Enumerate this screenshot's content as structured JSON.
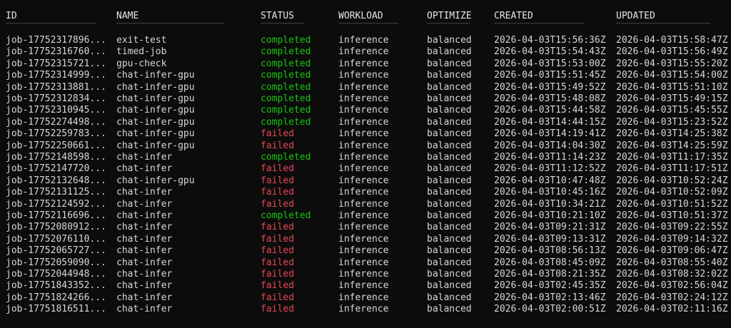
{
  "colors": {
    "background": "#0c0c0c",
    "text": "#d7d7d7",
    "completed": "#16c60c",
    "failed": "#e74856",
    "separator": "#4a4a4a"
  },
  "table": {
    "headers": {
      "id": "ID",
      "name": "NAME",
      "status": "STATUS",
      "workload": "WORKLOAD",
      "optimize": "OPTIMIZE",
      "created": "CREATED",
      "updated": "UPDATED"
    },
    "separators": {
      "id": "─────────────────────",
      "name": "─────────────────────────",
      "status": "──────────",
      "workload": "──────────────",
      "optimize": "──────────",
      "created": "─────────────────────",
      "updated": "──────────────────────"
    },
    "rows": [
      {
        "id": "job-17752317896...",
        "name": "exit-test",
        "status": "completed",
        "workload": "inference",
        "optimize": "balanced",
        "created": "2026-04-03T15:56:36Z",
        "updated": "2026-04-03T15:58:47Z"
      },
      {
        "id": "job-17752316760...",
        "name": "timed-job",
        "status": "completed",
        "workload": "inference",
        "optimize": "balanced",
        "created": "2026-04-03T15:54:43Z",
        "updated": "2026-04-03T15:56:49Z"
      },
      {
        "id": "job-17752315721...",
        "name": "gpu-check",
        "status": "completed",
        "workload": "inference",
        "optimize": "balanced",
        "created": "2026-04-03T15:53:00Z",
        "updated": "2026-04-03T15:55:20Z"
      },
      {
        "id": "job-17752314999...",
        "name": "chat-infer-gpu",
        "status": "completed",
        "workload": "inference",
        "optimize": "balanced",
        "created": "2026-04-03T15:51:45Z",
        "updated": "2026-04-03T15:54:00Z"
      },
      {
        "id": "job-17752313881...",
        "name": "chat-infer-gpu",
        "status": "completed",
        "workload": "inference",
        "optimize": "balanced",
        "created": "2026-04-03T15:49:52Z",
        "updated": "2026-04-03T15:51:10Z"
      },
      {
        "id": "job-17752312834...",
        "name": "chat-infer-gpu",
        "status": "completed",
        "workload": "inference",
        "optimize": "balanced",
        "created": "2026-04-03T15:48:08Z",
        "updated": "2026-04-03T15:49:15Z"
      },
      {
        "id": "job-17752310945...",
        "name": "chat-infer-gpu",
        "status": "completed",
        "workload": "inference",
        "optimize": "balanced",
        "created": "2026-04-03T15:44:58Z",
        "updated": "2026-04-03T15:45:55Z"
      },
      {
        "id": "job-17752274498...",
        "name": "chat-infer-gpu",
        "status": "completed",
        "workload": "inference",
        "optimize": "balanced",
        "created": "2026-04-03T14:44:15Z",
        "updated": "2026-04-03T15:23:52Z"
      },
      {
        "id": "job-17752259783...",
        "name": "chat-infer-gpu",
        "status": "failed",
        "workload": "inference",
        "optimize": "balanced",
        "created": "2026-04-03T14:19:41Z",
        "updated": "2026-04-03T14:25:38Z"
      },
      {
        "id": "job-17752250661...",
        "name": "chat-infer-gpu",
        "status": "failed",
        "workload": "inference",
        "optimize": "balanced",
        "created": "2026-04-03T14:04:30Z",
        "updated": "2026-04-03T14:25:59Z"
      },
      {
        "id": "job-17752148598...",
        "name": "chat-infer",
        "status": "completed",
        "workload": "inference",
        "optimize": "balanced",
        "created": "2026-04-03T11:14:23Z",
        "updated": "2026-04-03T11:17:35Z"
      },
      {
        "id": "job-17752147720...",
        "name": "chat-infer",
        "status": "failed",
        "workload": "inference",
        "optimize": "balanced",
        "created": "2026-04-03T11:12:52Z",
        "updated": "2026-04-03T11:17:51Z"
      },
      {
        "id": "job-17752132648...",
        "name": "chat-infer-gpu",
        "status": "failed",
        "workload": "inference",
        "optimize": "balanced",
        "created": "2026-04-03T10:47:48Z",
        "updated": "2026-04-03T10:52:24Z"
      },
      {
        "id": "job-17752131125...",
        "name": "chat-infer",
        "status": "failed",
        "workload": "inference",
        "optimize": "balanced",
        "created": "2026-04-03T10:45:16Z",
        "updated": "2026-04-03T10:52:09Z"
      },
      {
        "id": "job-17752124592...",
        "name": "chat-infer",
        "status": "failed",
        "workload": "inference",
        "optimize": "balanced",
        "created": "2026-04-03T10:34:21Z",
        "updated": "2026-04-03T10:51:52Z"
      },
      {
        "id": "job-17752116696...",
        "name": "chat-infer",
        "status": "completed",
        "workload": "inference",
        "optimize": "balanced",
        "created": "2026-04-03T10:21:10Z",
        "updated": "2026-04-03T10:51:37Z"
      },
      {
        "id": "job-17752080912...",
        "name": "chat-infer",
        "status": "failed",
        "workload": "inference",
        "optimize": "balanced",
        "created": "2026-04-03T09:21:31Z",
        "updated": "2026-04-03T09:22:55Z"
      },
      {
        "id": "job-17752076110...",
        "name": "chat-infer",
        "status": "failed",
        "workload": "inference",
        "optimize": "balanced",
        "created": "2026-04-03T09:13:31Z",
        "updated": "2026-04-03T09:14:32Z"
      },
      {
        "id": "job-17752065727...",
        "name": "chat-infer",
        "status": "failed",
        "workload": "inference",
        "optimize": "balanced",
        "created": "2026-04-03T08:56:13Z",
        "updated": "2026-04-03T09:06:47Z"
      },
      {
        "id": "job-17752059090...",
        "name": "chat-infer",
        "status": "failed",
        "workload": "inference",
        "optimize": "balanced",
        "created": "2026-04-03T08:45:09Z",
        "updated": "2026-04-03T08:55:40Z"
      },
      {
        "id": "job-17752044948...",
        "name": "chat-infer",
        "status": "failed",
        "workload": "inference",
        "optimize": "balanced",
        "created": "2026-04-03T08:21:35Z",
        "updated": "2026-04-03T08:32:02Z"
      },
      {
        "id": "job-17751843352...",
        "name": "chat-infer",
        "status": "failed",
        "workload": "inference",
        "optimize": "balanced",
        "created": "2026-04-03T02:45:35Z",
        "updated": "2026-04-03T02:56:04Z"
      },
      {
        "id": "job-17751824266...",
        "name": "chat-infer",
        "status": "failed",
        "workload": "inference",
        "optimize": "balanced",
        "created": "2026-04-03T02:13:46Z",
        "updated": "2026-04-03T02:24:12Z"
      },
      {
        "id": "job-17751816511...",
        "name": "chat-infer",
        "status": "failed",
        "workload": "inference",
        "optimize": "balanced",
        "created": "2026-04-03T02:00:51Z",
        "updated": "2026-04-03T02:11:16Z"
      }
    ]
  }
}
